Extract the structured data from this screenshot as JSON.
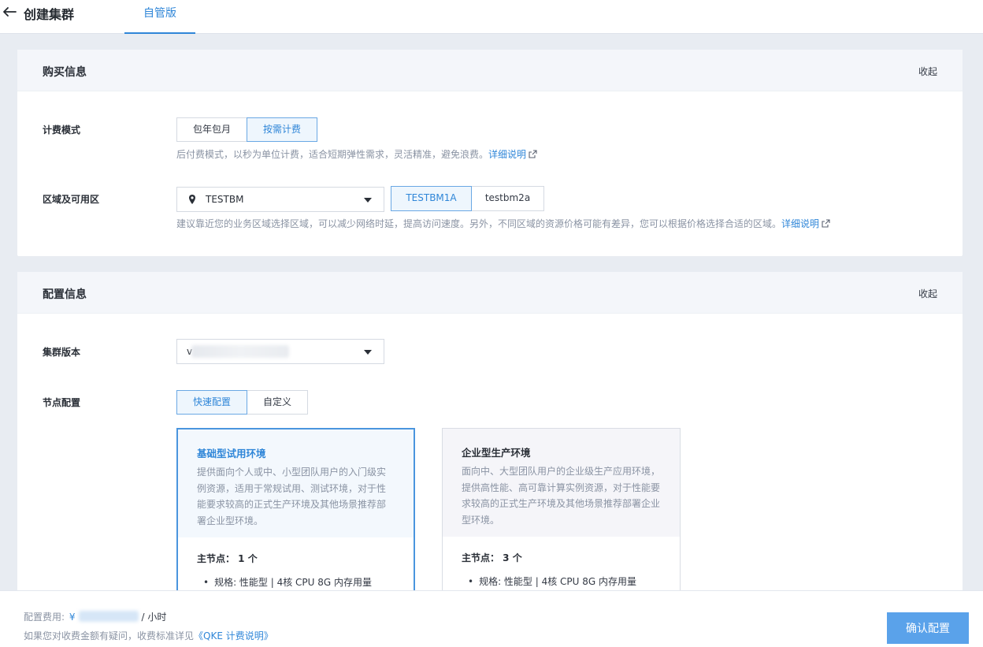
{
  "header": {
    "title": "创建集群",
    "tab": "自管版"
  },
  "purchase": {
    "title": "购买信息",
    "collapse": "收起",
    "billing": {
      "label": "计费模式",
      "options": [
        "包年包月",
        "按需计费"
      ],
      "selected": "按需计费",
      "hint": "后付费模式，以秒为单位计费，适合短期弹性需求，灵活精准，避免浪费。",
      "hint_link": "详细说明"
    },
    "region": {
      "label": "区域及可用区",
      "region_value": "TESTBM",
      "zones": [
        "TESTBM1A",
        "testbm2a"
      ],
      "selected_zone": "TESTBM1A",
      "hint": "建议靠近您的业务区域选择区域，可以减少网络时延，提高访问速度。另外，不同区域的资源价格可能有差异，您可以根据价格选择合适的区域。",
      "hint_link": "详细说明"
    }
  },
  "config": {
    "title": "配置信息",
    "collapse": "收起",
    "version": {
      "label": "集群版本",
      "value_prefix": "v"
    },
    "node": {
      "label": "节点配置",
      "options": [
        "快速配置",
        "自定义"
      ],
      "selected": "快速配置"
    },
    "envs": [
      {
        "title": "基础型试用环境",
        "desc": "提供面向个人或中、小型团队用户的入门级实例资源，适用于常规试用、测试环境，对于性能要求较高的正式生产环境及其他场景推荐部署企业型环境。",
        "master": "主节点： 1 个",
        "spec": "规格: 性能型 | 4核 CPU 8G 内存用量",
        "selected": true
      },
      {
        "title": "企业型生产环境",
        "desc": "面向中、大型团队用户的企业级生产应用环境，提供高性能、高可靠计算实例资源，对于性能要求较高的正式生产环境及其他场景推荐部署企业型环境。",
        "master": "主节点： 3 个",
        "spec": "规格: 性能型 | 4核 CPU 8G 内存用量",
        "selected": false
      }
    ]
  },
  "footer": {
    "cost_label": "配置费用:",
    "currency": "¥",
    "unit": "/ 小时",
    "billing_note": "如果您对收费金额有疑问，收费标准详见",
    "billing_link": "《QKE 计费说明》",
    "confirm": "确认配置"
  },
  "colors": {
    "accent": "#2f86d8",
    "confirm_button": "#5aa2ea"
  }
}
